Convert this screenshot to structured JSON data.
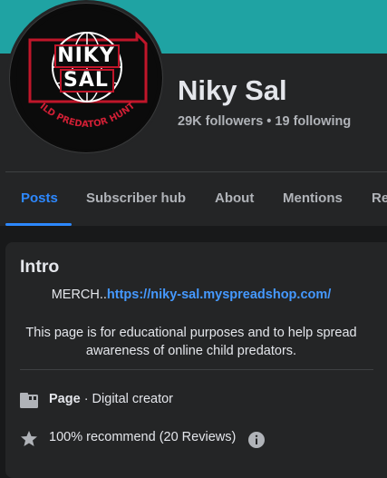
{
  "profile": {
    "name": "Niky Sal",
    "followers_text": "29K followers • 19 following",
    "avatar_logo": {
      "line1": "NIKY",
      "line2": "SAL",
      "ring_text": "CHILD PREDATOR HUNTER"
    }
  },
  "tabs": [
    {
      "label": "Posts",
      "active": true
    },
    {
      "label": "Subscriber hub",
      "active": false
    },
    {
      "label": "About",
      "active": false
    },
    {
      "label": "Mentions",
      "active": false
    },
    {
      "label": "Re",
      "active": false
    }
  ],
  "intro": {
    "title": "Intro",
    "merch_prefix": "MERCH..",
    "merch_link": "https://niky-sal.myspreadshop.com/",
    "bio": "This page is for educational purposes and to help spread awareness of online child predators.",
    "page_label": "Page",
    "page_category": " · Digital creator",
    "recommend_text": "100% recommend (20 Reviews)"
  },
  "colors": {
    "cover": "#1fa3a3",
    "accent": "#2d88ff",
    "link": "#4599ff",
    "background": "#18191a",
    "card": "#242526"
  },
  "icons": [
    "page-icon",
    "star-icon",
    "info-icon"
  ]
}
